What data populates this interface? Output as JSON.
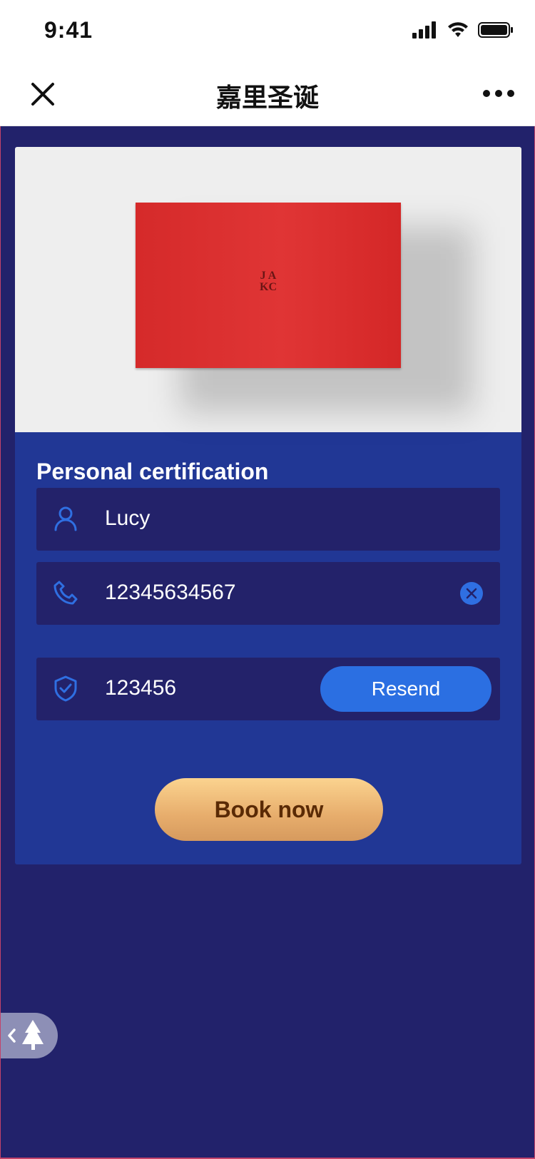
{
  "status": {
    "time": "9:41"
  },
  "nav": {
    "title": "嘉里圣诞"
  },
  "hero": {
    "logo_line1": "J A",
    "logo_line2": "KC"
  },
  "form": {
    "title": "Personal certification",
    "name_value": "Lucy",
    "phone_value": "12345634567",
    "code_value": "123456",
    "resend_label": "Resend",
    "book_label": "Book now"
  },
  "colors": {
    "background": "#22226b",
    "card": "#213795",
    "field": "#23226a",
    "accent": "#2b6fe2",
    "cta_top": "#fbd38f",
    "cta_bottom": "#d69a5e",
    "cta_text": "#5a2a05"
  },
  "icons": [
    "close-icon",
    "more-icon",
    "user-icon",
    "phone-icon",
    "shield-check-icon",
    "clear-icon",
    "back-tree-icon"
  ]
}
